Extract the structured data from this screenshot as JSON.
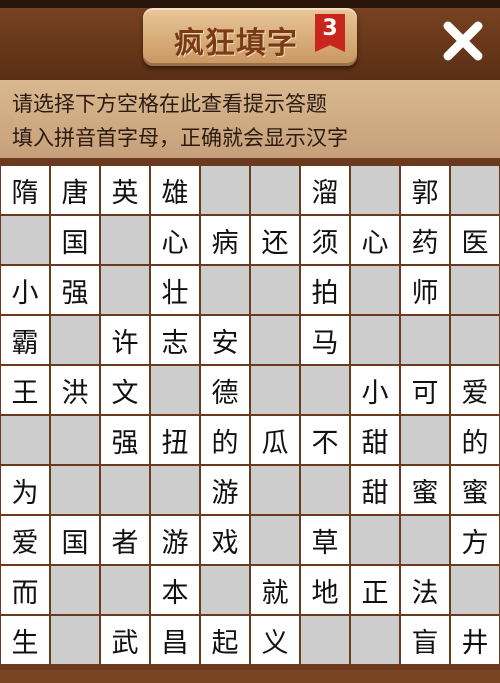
{
  "header": {
    "title": "疯狂填字",
    "level": "3",
    "close_icon": "close-x-icon"
  },
  "hints": {
    "line1": "请选择下方空格在此查看提示答题",
    "line2": "填入拼音首字母，正确就会显示汉字"
  },
  "colors": {
    "wood": "#6b3a1e",
    "panel": "#d2b086",
    "open_cell": "#ffffff",
    "empty_cell": "#cdcdcd",
    "badge": "#c8261c"
  },
  "grid": [
    [
      "隋",
      "唐",
      "英",
      "雄",
      "",
      "",
      "溜",
      "",
      "郭",
      ""
    ],
    [
      "",
      "国",
      "",
      "心",
      "病",
      "还",
      "须",
      "心",
      "药",
      "医"
    ],
    [
      "小",
      "强",
      "",
      "壮",
      "",
      "",
      "拍",
      "",
      "师",
      ""
    ],
    [
      "霸",
      "",
      "许",
      "志",
      "安",
      "",
      "马",
      "",
      "",
      ""
    ],
    [
      "王",
      "洪",
      "文",
      "",
      "德",
      "",
      "",
      "小",
      "可",
      "爱"
    ],
    [
      "",
      "",
      "强",
      "扭",
      "的",
      "瓜",
      "不",
      "甜",
      "",
      "的"
    ],
    [
      "为",
      "",
      "",
      "",
      "游",
      "",
      "",
      "甜",
      "蜜",
      "蜜"
    ],
    [
      "爱",
      "国",
      "者",
      "游",
      "戏",
      "",
      "草",
      "",
      "",
      "方"
    ],
    [
      "而",
      "",
      "",
      "本",
      "",
      "就",
      "地",
      "正",
      "法",
      ""
    ],
    [
      "生",
      "",
      "武",
      "昌",
      "起",
      "义",
      "",
      "",
      "盲",
      "井"
    ]
  ],
  "open_mask": [
    [
      1,
      1,
      1,
      1,
      0,
      0,
      1,
      0,
      1,
      0
    ],
    [
      0,
      1,
      0,
      1,
      1,
      1,
      1,
      1,
      1,
      1
    ],
    [
      1,
      1,
      0,
      1,
      0,
      0,
      1,
      0,
      1,
      0
    ],
    [
      1,
      0,
      1,
      1,
      1,
      0,
      1,
      0,
      0,
      0
    ],
    [
      1,
      1,
      1,
      0,
      1,
      0,
      0,
      1,
      1,
      1
    ],
    [
      0,
      0,
      1,
      1,
      1,
      1,
      1,
      1,
      0,
      1
    ],
    [
      1,
      0,
      0,
      0,
      1,
      0,
      0,
      1,
      1,
      1
    ],
    [
      1,
      1,
      1,
      1,
      1,
      0,
      1,
      0,
      0,
      1
    ],
    [
      1,
      0,
      0,
      1,
      0,
      1,
      1,
      1,
      1,
      0
    ],
    [
      1,
      0,
      1,
      1,
      1,
      1,
      0,
      0,
      1,
      1
    ]
  ]
}
